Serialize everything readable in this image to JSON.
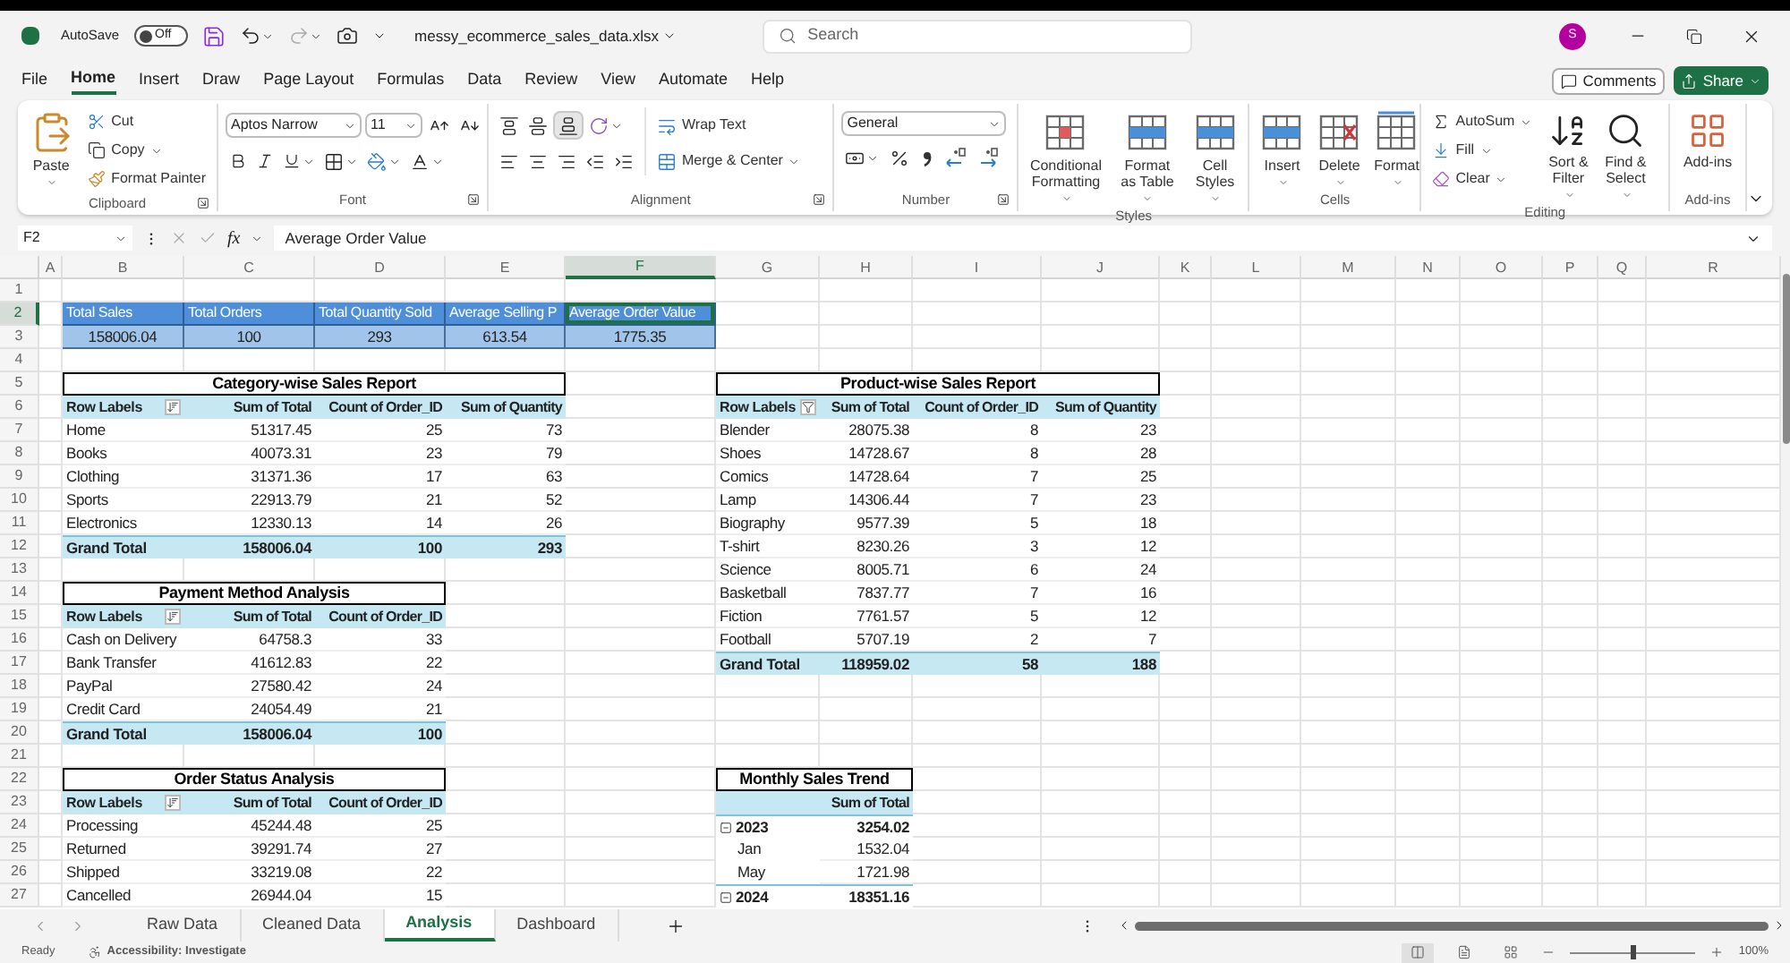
{
  "title_bar": {
    "autosave_label": "AutoSave",
    "autosave": {
      "label": "Off",
      "on": false
    },
    "filename": "messy_ecommerce_sales_data.xlsx",
    "search": {
      "placeholder": "Search"
    },
    "avatar": "S"
  },
  "menu_tabs": [
    {
      "label": "File",
      "selected": false
    },
    {
      "label": "Home",
      "selected": true
    },
    {
      "label": "Insert",
      "selected": false
    },
    {
      "label": "Draw",
      "selected": false
    },
    {
      "label": "Page Layout",
      "selected": false
    },
    {
      "label": "Formulas",
      "selected": false
    },
    {
      "label": "Data",
      "selected": false
    },
    {
      "label": "Review",
      "selected": false
    },
    {
      "label": "View",
      "selected": false
    },
    {
      "label": "Automate",
      "selected": false
    },
    {
      "label": "Help",
      "selected": false
    }
  ],
  "actions": {
    "comments": "Comments",
    "share": "Share"
  },
  "ribbon": {
    "clipboard": {
      "label": "Clipboard",
      "paste": "Paste",
      "cut": "Cut",
      "copy": "Copy",
      "format_painter": "Format Painter"
    },
    "font": {
      "label": "Font",
      "name": "Aptos Narrow",
      "size": "11"
    },
    "alignment": {
      "label": "Alignment",
      "wrap_text": "Wrap Text",
      "merge": "Merge & Center"
    },
    "number": {
      "label": "Number",
      "format": "General"
    },
    "styles": {
      "label": "Styles",
      "conditional": "Conditional Formatting",
      "format_table": "Format as Table",
      "cell_styles": "Cell Styles"
    },
    "cells": {
      "label": "Cells",
      "insert": "Insert",
      "delete": "Delete",
      "format": "Format"
    },
    "editing": {
      "label": "Editing",
      "autosum": "AutoSum",
      "fill": "Fill",
      "clear": "Clear",
      "sort": "Sort & Filter",
      "find": "Find & Select"
    },
    "addins": {
      "label": "Add-ins",
      "addins": "Add-ins"
    }
  },
  "formula_bar": {
    "name_box": "F2",
    "function_label": "fx",
    "value": "Average Order Value"
  },
  "sheet": {
    "columns": [
      {
        "label": "A",
        "selected": false
      },
      {
        "label": "B",
        "selected": false
      },
      {
        "label": "C",
        "selected": false
      },
      {
        "label": "D",
        "selected": false
      },
      {
        "label": "E",
        "selected": false
      },
      {
        "label": "F",
        "selected": true
      },
      {
        "label": "G",
        "selected": false
      },
      {
        "label": "H",
        "selected": false
      },
      {
        "label": "I",
        "selected": false
      },
      {
        "label": "J",
        "selected": false
      },
      {
        "label": "K",
        "selected": false
      },
      {
        "label": "L",
        "selected": false
      },
      {
        "label": "M",
        "selected": false
      },
      {
        "label": "N",
        "selected": false
      },
      {
        "label": "O",
        "selected": false
      },
      {
        "label": "P",
        "selected": false
      },
      {
        "label": "Q",
        "selected": false
      },
      {
        "label": "R",
        "selected": false
      }
    ],
    "rows": [
      {
        "label": "1",
        "selected": false
      },
      {
        "label": "2",
        "selected": true
      },
      {
        "label": "3",
        "selected": false
      },
      {
        "label": "4",
        "selected": false
      },
      {
        "label": "5",
        "selected": false
      },
      {
        "label": "6",
        "selected": false
      },
      {
        "label": "7",
        "selected": false
      },
      {
        "label": "8",
        "selected": false
      },
      {
        "label": "9",
        "selected": false
      },
      {
        "label": "10",
        "selected": false
      },
      {
        "label": "11",
        "selected": false
      },
      {
        "label": "12",
        "selected": false
      },
      {
        "label": "13",
        "selected": false
      },
      {
        "label": "14",
        "selected": false
      },
      {
        "label": "15",
        "selected": false
      },
      {
        "label": "16",
        "selected": false
      },
      {
        "label": "17",
        "selected": false
      },
      {
        "label": "18",
        "selected": false
      },
      {
        "label": "19",
        "selected": false
      },
      {
        "label": "20",
        "selected": false
      },
      {
        "label": "21",
        "selected": false
      },
      {
        "label": "22",
        "selected": false
      },
      {
        "label": "23",
        "selected": false
      },
      {
        "label": "24",
        "selected": false
      },
      {
        "label": "25",
        "selected": false
      },
      {
        "label": "26",
        "selected": false
      },
      {
        "label": "27",
        "selected": false
      }
    ],
    "kpis": [
      {
        "label": "Total Sales",
        "value": "158006.04",
        "selected": false
      },
      {
        "label": "Total Orders",
        "value": "100",
        "selected": false
      },
      {
        "label": "Total Quantity Sold",
        "value": "293",
        "selected": false
      },
      {
        "label": "Average Selling P",
        "value": "613.54",
        "selected": false
      },
      {
        "label": "Average Order Value",
        "value": "1775.35",
        "selected": true
      }
    ],
    "pivots": [
      {
        "title": "Category-wise Sales Report",
        "filtered": false,
        "columns": [
          "Row Labels",
          "Sum of Total",
          "Count of Order_ID",
          "Sum of Quantity"
        ],
        "rows": [
          [
            "Home",
            "51317.45",
            "25",
            "73"
          ],
          [
            "Books",
            "40073.31",
            "23",
            "79"
          ],
          [
            "Clothing",
            "31371.36",
            "17",
            "63"
          ],
          [
            "Sports",
            "22913.79",
            "21",
            "52"
          ],
          [
            "Electronics",
            "12330.13",
            "14",
            "26"
          ]
        ],
        "total": [
          "Grand Total",
          "158006.04",
          "100",
          "293"
        ]
      },
      {
        "title": "Product-wise Sales Report",
        "filtered": true,
        "columns": [
          "Row Labels",
          "Sum of Total",
          "Count of Order_ID",
          "Sum of Quantity"
        ],
        "rows": [
          [
            "Blender",
            "28075.38",
            "8",
            "23"
          ],
          [
            "Shoes",
            "14728.67",
            "8",
            "28"
          ],
          [
            "Comics",
            "14728.64",
            "7",
            "25"
          ],
          [
            "Lamp",
            "14306.44",
            "7",
            "23"
          ],
          [
            "Biography",
            "9577.39",
            "5",
            "18"
          ],
          [
            "T-shirt",
            "8230.26",
            "3",
            "12"
          ],
          [
            "Science",
            "8005.71",
            "6",
            "24"
          ],
          [
            "Basketball",
            "7837.77",
            "7",
            "16"
          ],
          [
            "Fiction",
            "7761.57",
            "5",
            "12"
          ],
          [
            "Football",
            "5707.19",
            "2",
            "7"
          ]
        ],
        "total": [
          "Grand Total",
          "118959.02",
          "58",
          "188"
        ]
      },
      {
        "title": "Payment Method Analysis",
        "filtered": false,
        "columns": [
          "Row Labels",
          "Sum of Total",
          "Count of Order_ID"
        ],
        "rows": [
          [
            "Cash on Delivery",
            "64758.3",
            "33"
          ],
          [
            "Bank Transfer",
            "41612.83",
            "22"
          ],
          [
            "PayPal",
            "27580.42",
            "24"
          ],
          [
            "Credit Card",
            "24054.49",
            "21"
          ]
        ],
        "total": [
          "Grand Total",
          "158006.04",
          "100"
        ]
      },
      {
        "title": "Order Status Analysis",
        "filtered": false,
        "columns": [
          "Row Labels",
          "Sum of Total",
          "Count of Order_ID"
        ],
        "rows": [
          [
            "Processing",
            "45244.48",
            "25"
          ],
          [
            "Returned",
            "39291.74",
            "27"
          ],
          [
            "Shipped",
            "33219.08",
            "22"
          ],
          [
            "Cancelled",
            "26944.04",
            "15"
          ]
        ]
      }
    ],
    "monthly": {
      "title": "Monthly Sales Trend",
      "header": "Sum of Total",
      "rows": [
        {
          "kind": "year",
          "label": "2023",
          "value": "3254.02",
          "expanded": true
        },
        {
          "kind": "month",
          "label": "Jan",
          "value": "1532.04"
        },
        {
          "kind": "month",
          "label": "May",
          "value": "1721.98"
        },
        {
          "kind": "year",
          "label": "2024",
          "value": "18351.16",
          "expanded": true
        }
      ]
    }
  },
  "sheet_tabs": [
    {
      "label": "Raw Data",
      "selected": false
    },
    {
      "label": "Cleaned Data",
      "selected": false
    },
    {
      "label": "Analysis",
      "selected": true
    },
    {
      "label": "Dashboard",
      "selected": false
    }
  ],
  "status_bar": {
    "ready": "Ready",
    "accessibility": "Accessibility: Investigate",
    "views": [
      {
        "selected": true
      },
      {
        "selected": false
      },
      {
        "selected": false
      }
    ],
    "zoom": {
      "label": "100%",
      "level": 0.5
    }
  }
}
